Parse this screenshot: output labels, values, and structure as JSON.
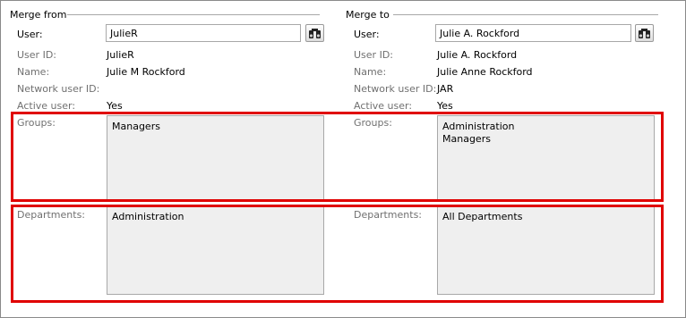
{
  "merge_from": {
    "title": "Merge from",
    "user_label": "User:",
    "user_value": "JulieR",
    "user_id_label": "User ID:",
    "user_id_value": "JulieR",
    "name_label": "Name:",
    "name_value": "Julie M Rockford",
    "network_label": "Network user ID:",
    "network_value": "",
    "active_label": "Active user:",
    "active_value": "Yes",
    "groups_label": "Groups:",
    "groups": [
      "Managers"
    ],
    "departments_label": "Departments:",
    "departments": [
      "Administration"
    ]
  },
  "merge_to": {
    "title": "Merge to",
    "user_label": "User:",
    "user_value": "Julie A. Rockford",
    "user_id_label": "User ID:",
    "user_id_value": "Julie A. Rockford",
    "name_label": "Name:",
    "name_value": "Julie Anne Rockford",
    "network_label": "Network user ID:",
    "network_value": "JAR",
    "active_label": "Active user:",
    "active_value": "Yes",
    "groups_label": "Groups:",
    "groups": [
      "Administration",
      "Managers"
    ],
    "departments_label": "Departments:",
    "departments": [
      "All Departments"
    ]
  },
  "icons": {
    "find_user": "binoculars-icon"
  },
  "colors": {
    "highlight": "#e00000",
    "listbox_bg": "#efefef",
    "label_gray": "#707070"
  }
}
